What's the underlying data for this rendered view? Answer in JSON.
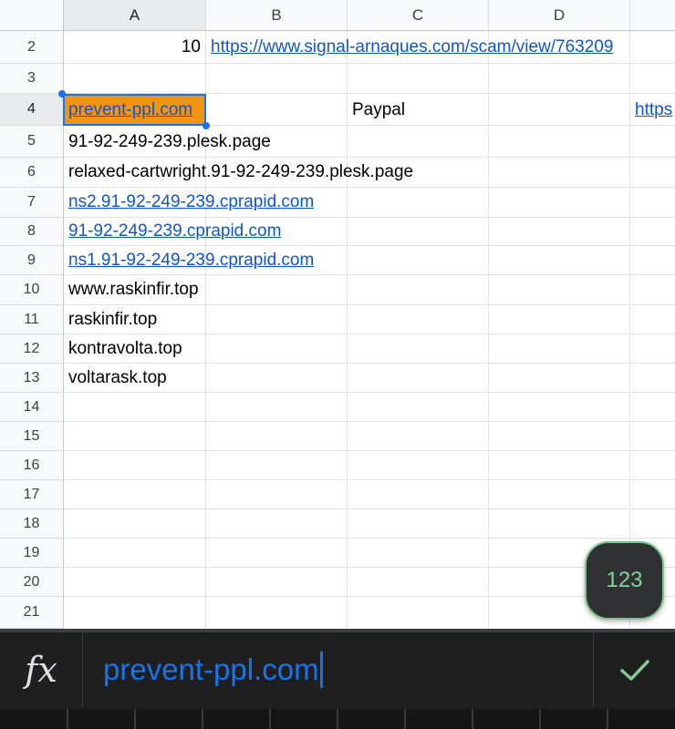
{
  "columns": [
    "A",
    "B",
    "C",
    "D"
  ],
  "selected_column": "A",
  "rows": [
    "2",
    "3",
    "4",
    "5",
    "6",
    "7",
    "8",
    "9",
    "10",
    "11",
    "12",
    "13",
    "14",
    "15",
    "16",
    "17",
    "18",
    "19",
    "20",
    "21"
  ],
  "selected_row": "4",
  "cells": {
    "r2": {
      "a": "10",
      "b": "https://www.signal-arnaques.com/scam/view/763209"
    },
    "r4": {
      "a": "prevent-ppl.com",
      "c": "Paypal",
      "e": "https"
    },
    "r5": {
      "a": "91-92-249-239.plesk.page"
    },
    "r6": {
      "a": "relaxed-cartwright.91-92-249-239.plesk.page"
    },
    "r7": {
      "a": "ns2.91-92-249-239.cprapid.com"
    },
    "r8": {
      "a": "91-92-249-239.cprapid.com"
    },
    "r9": {
      "a": "ns1.91-92-249-239.cprapid.com"
    },
    "r10": {
      "a": "www.raskinfir.top"
    },
    "r11": {
      "a": "raskinfir.top"
    },
    "r12": {
      "a": "kontravolta.top"
    },
    "r13": {
      "a": "voltarask.top"
    }
  },
  "selected_cell_fill": "#f29410",
  "link_color": "#1155cc",
  "fab_label": "123",
  "formula_bar": {
    "fx_label": "fx",
    "value": "prevent-ppl.com",
    "confirm_icon": "checkmark-icon"
  }
}
